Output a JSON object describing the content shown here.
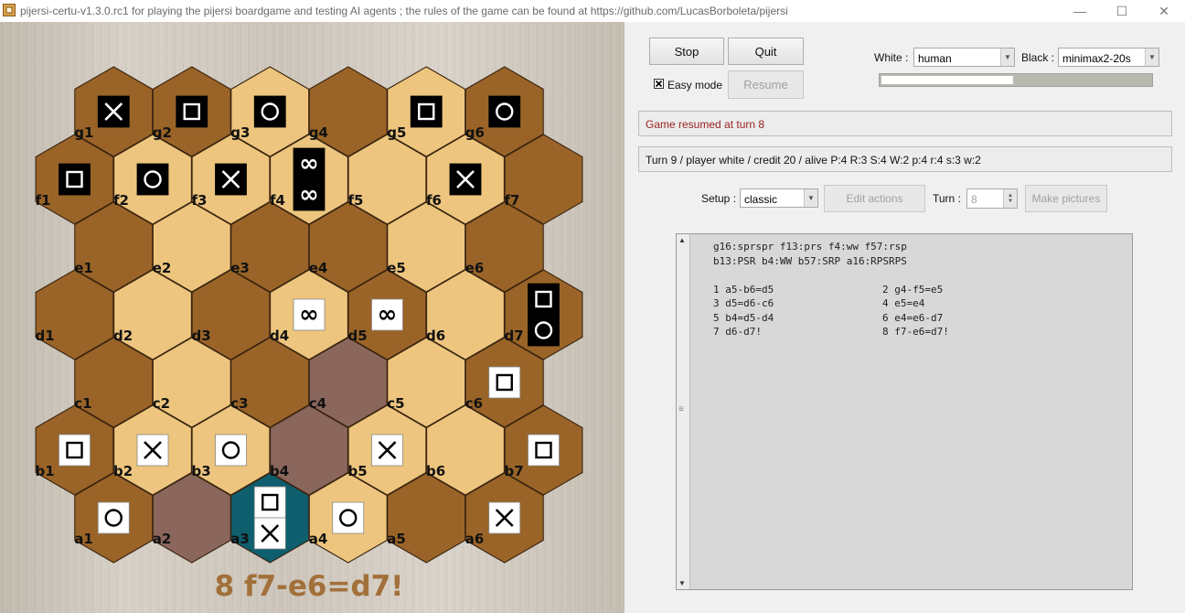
{
  "window": {
    "title": "pijersi-certu-v1.3.0.rc1 for playing the pijersi boardgame and testing AI agents ; the rules of the game can be found at https://github.com/LucasBorboleta/pijersi"
  },
  "controls": {
    "stop_label": "Stop",
    "quit_label": "Quit",
    "resume_label": "Resume",
    "easy_mode_label": "Easy mode",
    "easy_mode_checked": true,
    "white_label": "White :",
    "white_value": "human",
    "black_label": "Black :",
    "black_value": "minimax2-20s",
    "progress": 0.49
  },
  "status": {
    "message": "Game resumed at turn 8",
    "turn_info": "Turn 9 / player white / credit 20 / alive P:4 R:3 S:4 W:2 p:4 r:4 s:3 w:2"
  },
  "setup": {
    "setup_label": "Setup :",
    "setup_value": "classic",
    "edit_actions_label": "Edit actions",
    "turn_label": "Turn :",
    "turn_value": "8",
    "make_pictures_label": "Make pictures"
  },
  "log": {
    "line1": "g16:sprspr f13:prs f4:ww f57:rsp",
    "line2": "b13:PSR b4:WW b57:SRP a16:RPSRPS",
    "moves": [
      {
        "left": "1 a5-b6=d5",
        "right": "2 g4-f5=e5"
      },
      {
        "left": "3 d5=d6-c6",
        "right": "4 e5=e4"
      },
      {
        "left": "5 b4=d5-d4",
        "right": "6 e4=e6-d7"
      },
      {
        "left": "7 d6-d7!",
        "right": "8 f7-e6=d7!"
      }
    ]
  },
  "board": {
    "last_move": "8 f7-e6=d7!",
    "rows": [
      {
        "row": "g",
        "cells": [
          "g1",
          "g2",
          "g3",
          "g4",
          "g5",
          "g6"
        ]
      },
      {
        "row": "f",
        "cells": [
          "f1",
          "f2",
          "f3",
          "f4",
          "f5",
          "f6",
          "f7"
        ]
      },
      {
        "row": "e",
        "cells": [
          "e1",
          "e2",
          "e3",
          "e4",
          "e5",
          "e6"
        ]
      },
      {
        "row": "d",
        "cells": [
          "d1",
          "d2",
          "d3",
          "d4",
          "d5",
          "d6",
          "d7"
        ]
      },
      {
        "row": "c",
        "cells": [
          "c1",
          "c2",
          "c3",
          "c4",
          "c5",
          "c6"
        ]
      },
      {
        "row": "b",
        "cells": [
          "b1",
          "b2",
          "b3",
          "b4",
          "b5",
          "b6",
          "b7"
        ]
      },
      {
        "row": "a",
        "cells": [
          "a1",
          "a2",
          "a3",
          "a4",
          "a5",
          "a6"
        ]
      }
    ],
    "light_cells": [
      "g3",
      "g5",
      "f2",
      "f3",
      "f4",
      "f5",
      "f6",
      "e2",
      "e5",
      "d2",
      "d4",
      "d6",
      "c2",
      "c5",
      "b2",
      "b3",
      "b5",
      "b6",
      "a3",
      "a4"
    ],
    "highlight_cells": [
      "c4",
      "b4",
      "a2"
    ],
    "selected_cells": [
      "a3"
    ],
    "pieces": [
      {
        "cell": "g1",
        "color": "black",
        "kinds": [
          "scissors"
        ]
      },
      {
        "cell": "g2",
        "color": "black",
        "kinds": [
          "paper"
        ]
      },
      {
        "cell": "g3",
        "color": "black",
        "kinds": [
          "rock"
        ]
      },
      {
        "cell": "g5",
        "color": "black",
        "kinds": [
          "paper"
        ]
      },
      {
        "cell": "g6",
        "color": "black",
        "kinds": [
          "rock"
        ]
      },
      {
        "cell": "f1",
        "color": "black",
        "kinds": [
          "paper"
        ]
      },
      {
        "cell": "f2",
        "color": "black",
        "kinds": [
          "rock"
        ]
      },
      {
        "cell": "f3",
        "color": "black",
        "kinds": [
          "scissors"
        ]
      },
      {
        "cell": "f4",
        "color": "black",
        "kinds": [
          "wise",
          "wise"
        ]
      },
      {
        "cell": "f6",
        "color": "black",
        "kinds": [
          "scissors"
        ]
      },
      {
        "cell": "d7",
        "color": "black",
        "kinds": [
          "paper",
          "rock"
        ]
      },
      {
        "cell": "d4",
        "color": "white",
        "kinds": [
          "wise"
        ]
      },
      {
        "cell": "d5",
        "color": "white",
        "kinds": [
          "wise"
        ]
      },
      {
        "cell": "c6",
        "color": "white",
        "kinds": [
          "paper"
        ]
      },
      {
        "cell": "b1",
        "color": "white",
        "kinds": [
          "paper"
        ]
      },
      {
        "cell": "b2",
        "color": "white",
        "kinds": [
          "scissors"
        ]
      },
      {
        "cell": "b3",
        "color": "white",
        "kinds": [
          "rock"
        ]
      },
      {
        "cell": "b5",
        "color": "white",
        "kinds": [
          "scissors"
        ]
      },
      {
        "cell": "b7",
        "color": "white",
        "kinds": [
          "paper"
        ]
      },
      {
        "cell": "a1",
        "color": "white",
        "kinds": [
          "rock"
        ]
      },
      {
        "cell": "a3",
        "color": "white",
        "kinds": [
          "paper",
          "scissors"
        ]
      },
      {
        "cell": "a4",
        "color": "white",
        "kinds": [
          "rock"
        ]
      },
      {
        "cell": "a6",
        "color": "white",
        "kinds": [
          "scissors"
        ]
      }
    ],
    "colors": {
      "dark_cell": "#9a6428",
      "light_cell": "#edc57e",
      "highlight_cell": "#8a665c",
      "selected_cell": "#0e5e6e",
      "last_move_text": "#a2703a"
    }
  }
}
